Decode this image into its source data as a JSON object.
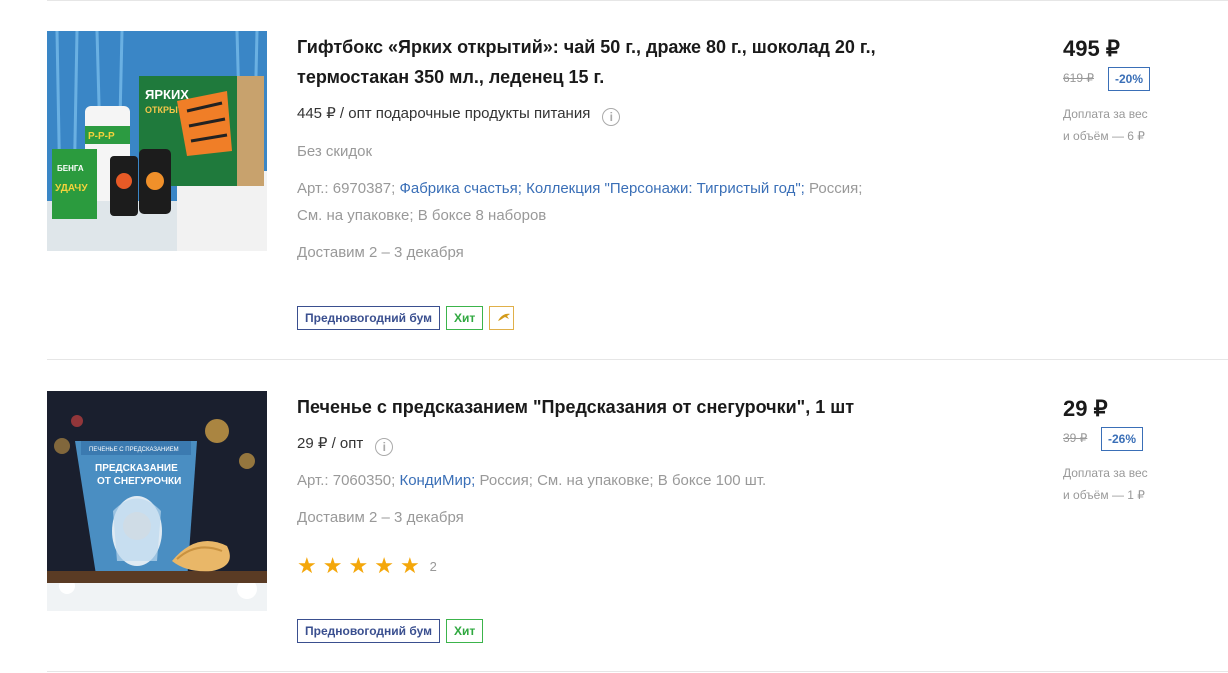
{
  "products": [
    {
      "title": "Гифтбокс «Ярких открытий»: чай 50 г., драже 80 г., шоколад 20 г., термостакан 350 мл., леденец 15 г.",
      "opt_price": "445 ₽ / опт подарочные продукты питания",
      "discount_note": "Без скидок",
      "art": "Арт.: 6970387;",
      "brand": "Фабрика счастья;",
      "collection": "Коллекция \"Персонажи: Тигристый год\";",
      "country": "Россия;",
      "pack": "См. на упаковке;",
      "box": "В боксе 8 наборов",
      "delivery": "Доставим 2 – 3 декабря",
      "badge_promo": "Предновогодний бум",
      "badge_hit": "Хит",
      "price": "495 ₽",
      "old_price": "619 ₽",
      "discount": "-20%",
      "extra_line1": "Доплата за вес",
      "extra_line2": "и объём — 6 ₽",
      "image": {
        "text1": "ЯРКИХ",
        "text2": "ОТКРЫТИЙ",
        "text3": "Р-Р-Р",
        "text4": "БЕНГА ЛОВИ УДАЧУ ЗА ХВОСТ"
      }
    },
    {
      "title": "Печенье с предсказанием \"Предсказания от снегурочки\", 1 шт",
      "opt_price": "29 ₽ / опт",
      "art": "Арт.: 7060350;",
      "brand": "КондиМир;",
      "country": "Россия;",
      "pack": "См. на упаковке;",
      "box": "В боксе 100 шт.",
      "delivery": "Доставим 2 – 3 декабря",
      "rating": 5,
      "rating_count": "2",
      "badge_promo": "Предновогодний бум",
      "badge_hit": "Хит",
      "price": "29 ₽",
      "old_price": "39 ₽",
      "discount": "-26%",
      "extra_line1": "Доплата за вес",
      "extra_line2": "и объём — 1 ₽",
      "image": {
        "text1": "ПЕЧЕНЬЕ С ПРЕДСКАЗАНИЕМ",
        "text2": "ПРЕДСКАЗАНИЕ",
        "text3": "ОТ СНЕГУРОЧКИ"
      }
    }
  ],
  "icons": {
    "info": "info-icon",
    "star": "star-icon",
    "promo": "dolphin-icon"
  },
  "colors": {
    "accent": "#3a6fb7",
    "hit": "#2fa83f",
    "star": "#f4a70b",
    "promo": "#3a4f8f"
  }
}
